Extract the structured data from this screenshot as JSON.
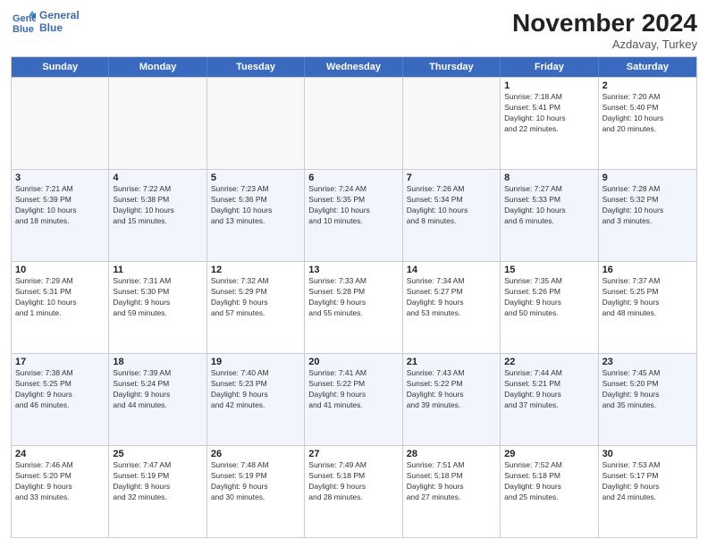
{
  "header": {
    "logo_line1": "General",
    "logo_line2": "Blue",
    "month": "November 2024",
    "location": "Azdavay, Turkey"
  },
  "weekdays": [
    "Sunday",
    "Monday",
    "Tuesday",
    "Wednesday",
    "Thursday",
    "Friday",
    "Saturday"
  ],
  "rows": [
    [
      {
        "day": "",
        "info": ""
      },
      {
        "day": "",
        "info": ""
      },
      {
        "day": "",
        "info": ""
      },
      {
        "day": "",
        "info": ""
      },
      {
        "day": "",
        "info": ""
      },
      {
        "day": "1",
        "info": "Sunrise: 7:18 AM\nSunset: 5:41 PM\nDaylight: 10 hours\nand 22 minutes."
      },
      {
        "day": "2",
        "info": "Sunrise: 7:20 AM\nSunset: 5:40 PM\nDaylight: 10 hours\nand 20 minutes."
      }
    ],
    [
      {
        "day": "3",
        "info": "Sunrise: 7:21 AM\nSunset: 5:39 PM\nDaylight: 10 hours\nand 18 minutes."
      },
      {
        "day": "4",
        "info": "Sunrise: 7:22 AM\nSunset: 5:38 PM\nDaylight: 10 hours\nand 15 minutes."
      },
      {
        "day": "5",
        "info": "Sunrise: 7:23 AM\nSunset: 5:36 PM\nDaylight: 10 hours\nand 13 minutes."
      },
      {
        "day": "6",
        "info": "Sunrise: 7:24 AM\nSunset: 5:35 PM\nDaylight: 10 hours\nand 10 minutes."
      },
      {
        "day": "7",
        "info": "Sunrise: 7:26 AM\nSunset: 5:34 PM\nDaylight: 10 hours\nand 8 minutes."
      },
      {
        "day": "8",
        "info": "Sunrise: 7:27 AM\nSunset: 5:33 PM\nDaylight: 10 hours\nand 6 minutes."
      },
      {
        "day": "9",
        "info": "Sunrise: 7:28 AM\nSunset: 5:32 PM\nDaylight: 10 hours\nand 3 minutes."
      }
    ],
    [
      {
        "day": "10",
        "info": "Sunrise: 7:29 AM\nSunset: 5:31 PM\nDaylight: 10 hours\nand 1 minute."
      },
      {
        "day": "11",
        "info": "Sunrise: 7:31 AM\nSunset: 5:30 PM\nDaylight: 9 hours\nand 59 minutes."
      },
      {
        "day": "12",
        "info": "Sunrise: 7:32 AM\nSunset: 5:29 PM\nDaylight: 9 hours\nand 57 minutes."
      },
      {
        "day": "13",
        "info": "Sunrise: 7:33 AM\nSunset: 5:28 PM\nDaylight: 9 hours\nand 55 minutes."
      },
      {
        "day": "14",
        "info": "Sunrise: 7:34 AM\nSunset: 5:27 PM\nDaylight: 9 hours\nand 53 minutes."
      },
      {
        "day": "15",
        "info": "Sunrise: 7:35 AM\nSunset: 5:26 PM\nDaylight: 9 hours\nand 50 minutes."
      },
      {
        "day": "16",
        "info": "Sunrise: 7:37 AM\nSunset: 5:25 PM\nDaylight: 9 hours\nand 48 minutes."
      }
    ],
    [
      {
        "day": "17",
        "info": "Sunrise: 7:38 AM\nSunset: 5:25 PM\nDaylight: 9 hours\nand 46 minutes."
      },
      {
        "day": "18",
        "info": "Sunrise: 7:39 AM\nSunset: 5:24 PM\nDaylight: 9 hours\nand 44 minutes."
      },
      {
        "day": "19",
        "info": "Sunrise: 7:40 AM\nSunset: 5:23 PM\nDaylight: 9 hours\nand 42 minutes."
      },
      {
        "day": "20",
        "info": "Sunrise: 7:41 AM\nSunset: 5:22 PM\nDaylight: 9 hours\nand 41 minutes."
      },
      {
        "day": "21",
        "info": "Sunrise: 7:43 AM\nSunset: 5:22 PM\nDaylight: 9 hours\nand 39 minutes."
      },
      {
        "day": "22",
        "info": "Sunrise: 7:44 AM\nSunset: 5:21 PM\nDaylight: 9 hours\nand 37 minutes."
      },
      {
        "day": "23",
        "info": "Sunrise: 7:45 AM\nSunset: 5:20 PM\nDaylight: 9 hours\nand 35 minutes."
      }
    ],
    [
      {
        "day": "24",
        "info": "Sunrise: 7:46 AM\nSunset: 5:20 PM\nDaylight: 9 hours\nand 33 minutes."
      },
      {
        "day": "25",
        "info": "Sunrise: 7:47 AM\nSunset: 5:19 PM\nDaylight: 9 hours\nand 32 minutes."
      },
      {
        "day": "26",
        "info": "Sunrise: 7:48 AM\nSunset: 5:19 PM\nDaylight: 9 hours\nand 30 minutes."
      },
      {
        "day": "27",
        "info": "Sunrise: 7:49 AM\nSunset: 5:18 PM\nDaylight: 9 hours\nand 28 minutes."
      },
      {
        "day": "28",
        "info": "Sunrise: 7:51 AM\nSunset: 5:18 PM\nDaylight: 9 hours\nand 27 minutes."
      },
      {
        "day": "29",
        "info": "Sunrise: 7:52 AM\nSunset: 5:18 PM\nDaylight: 9 hours\nand 25 minutes."
      },
      {
        "day": "30",
        "info": "Sunrise: 7:53 AM\nSunset: 5:17 PM\nDaylight: 9 hours\nand 24 minutes."
      }
    ]
  ]
}
